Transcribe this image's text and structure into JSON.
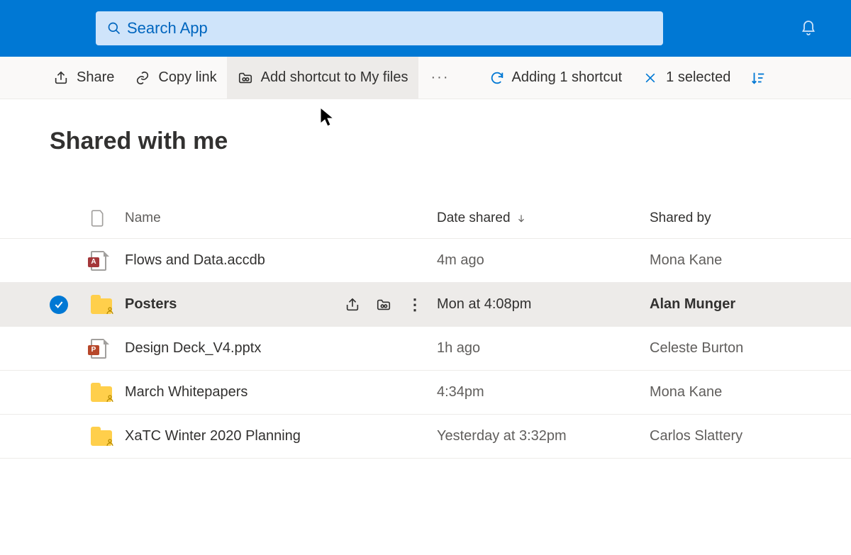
{
  "nav": {
    "search_placeholder": "Search App"
  },
  "toolbar": {
    "share": "Share",
    "copy_link": "Copy link",
    "add_shortcut": "Add shortcut to My files",
    "more": "···",
    "status": "Adding 1 shortcut",
    "selected": "1 selected"
  },
  "page": {
    "title": "Shared with me"
  },
  "columns": {
    "name": "Name",
    "date": "Date shared",
    "by": "Shared by"
  },
  "rows": [
    {
      "name": "Flows and Data.accdb",
      "date": "4m ago",
      "by": "Mona Kane",
      "type": "access",
      "selected": false
    },
    {
      "name": "Posters",
      "date": "Mon at 4:08pm",
      "by": "Alan Munger",
      "type": "folder",
      "selected": true
    },
    {
      "name": "Design Deck_V4.pptx",
      "date": "1h ago",
      "by": "Celeste Burton",
      "type": "ppt",
      "selected": false
    },
    {
      "name": "March Whitepapers",
      "date": "4:34pm",
      "by": "Mona Kane",
      "type": "folder",
      "selected": false
    },
    {
      "name": "XaTC Winter 2020 Planning",
      "date": "Yesterday at 3:32pm",
      "by": "Carlos Slattery",
      "type": "folder",
      "selected": false
    }
  ]
}
